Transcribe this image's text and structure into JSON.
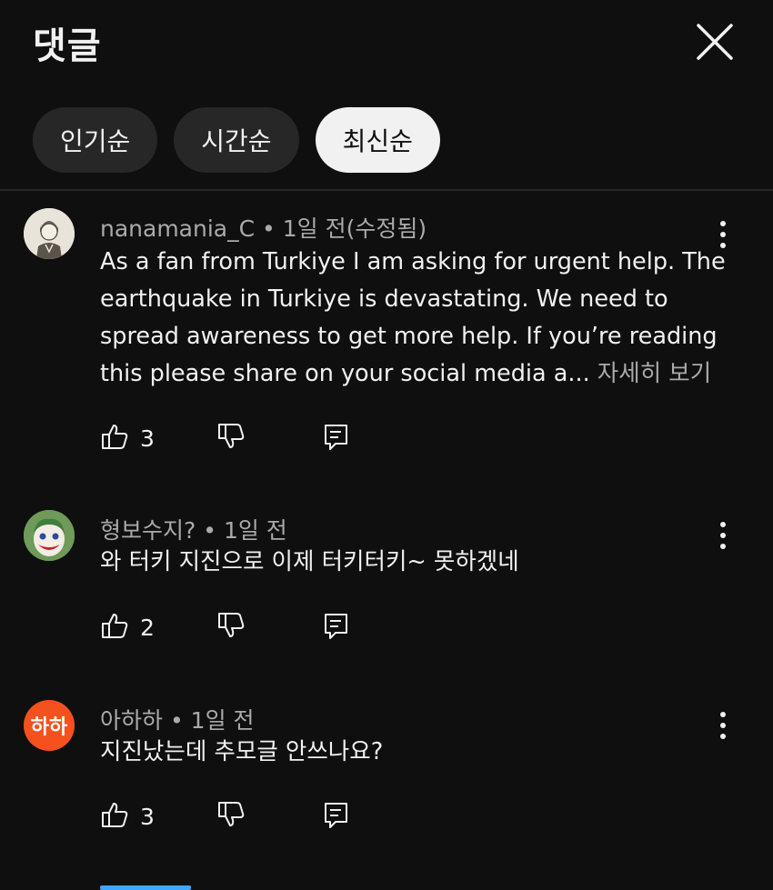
{
  "header": {
    "title": "댓글",
    "close_icon": "close-icon"
  },
  "sort_chips": [
    {
      "label": "인기순",
      "active": false
    },
    {
      "label": "시간순",
      "active": false
    },
    {
      "label": "최신순",
      "active": true
    }
  ],
  "comments": [
    {
      "author": "nanamania_C",
      "time": "1일 전(수정됨)",
      "text": "As a fan from Turkiye I am asking for urgent help. The earthquake in Turkiye is devastating. We need to spread awareness to get more help. If you’re reading this please share on your social media a...",
      "more_label": "자세히 보기",
      "likes": "3"
    },
    {
      "author": "형보수지?",
      "time": "1일 전",
      "text": "와 터키 지진으로 이제 터키터키~ 못하겠네",
      "likes": "2"
    },
    {
      "author": "아하하",
      "time": "1일 전",
      "avatar_text": "하하",
      "text": "지진났는데 추모글 안쓰나요?",
      "likes": "3"
    }
  ],
  "colors": {
    "background": "#0f0f0f",
    "chip": "#272727",
    "chip_active": "#f1f1f1",
    "muted_text": "#aaaaaa",
    "avatar_orange": "#f4511e"
  },
  "icons": [
    "like-icon",
    "dislike-icon",
    "reply-icon",
    "more-vert-icon"
  ]
}
